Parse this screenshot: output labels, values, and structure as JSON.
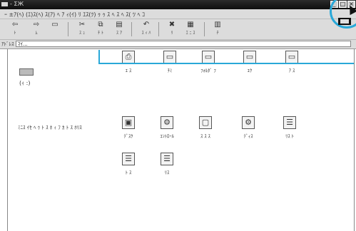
{
  "window": {
    "title": "- ΣЖ",
    "min_glyph": "_",
    "max_glyph": "□",
    "close_glyph": "×"
  },
  "menu": [
    "ｰ ±ｱ(ﾍ) (ｴ)ｽ(ﾍ) ｽ(ｱ) ﾍ ｱ ｨ(ｲ) ﾘ ｴｽ(ﾂ) ｩ ｩ ｽ ﾍ ｽ ﾍ ｽ( ﾂ ﾍ ｺ"
  ],
  "toolbar": [
    {
      "icon": "back-icon",
      "glyph": "⇦",
      "label": "ﾄ"
    },
    {
      "icon": "forward-icon",
      "glyph": "⇨",
      "label": "ﾑ"
    },
    {
      "icon": "up-icon",
      "glyph": "▭",
      "label": ""
    },
    {
      "icon": "cut-icon",
      "glyph": "✂",
      "label": "ｽ ｭ"
    },
    {
      "icon": "copy-icon",
      "glyph": "⧉",
      "label": "ﾁ ﾄ"
    },
    {
      "icon": "paste-icon",
      "glyph": "▤",
      "label": "ｽ ｱ"
    },
    {
      "icon": "undo-icon",
      "glyph": "↶",
      "label": "ｽ ｨ ﾊ"
    },
    {
      "icon": "delete-icon",
      "glyph": "✖",
      "label": "ﾘ"
    },
    {
      "icon": "properties-icon",
      "glyph": "▦",
      "label": "ｴ ﾆ ｽ"
    },
    {
      "icon": "views-icon",
      "glyph": "▥",
      "label": "ﾁ"
    }
  ],
  "address": {
    "label": "ｱﾄﾞﾚｽ",
    "value": "ﾏｲ..."
  },
  "leftpane": {
    "drive_label": "(ｨ :)",
    "description": "ﾐﾆｽ ｲｾ ﾍ ｩ ﾄ ｽ ﾎ ｨ ﾌ ｶ ﾄ ｽ ﾎﾘｽ"
  },
  "items": [
    {
      "icon": "printer-icon",
      "glyph": "⎙",
      "label": "ｴ ｽ"
    },
    {
      "icon": "folder-icon",
      "glyph": "▭",
      "label": "ﾁﾐ"
    },
    {
      "icon": "folder-icon",
      "glyph": "▭",
      "label": "ﾌｫﾙﾀﾞ ﾌ"
    },
    {
      "icon": "folder-icon",
      "glyph": "▭",
      "label": "ｴｸ"
    },
    {
      "icon": "folder-icon",
      "glyph": "▭",
      "label": "ｱ ｽ"
    },
    {
      "icon": "monitor-icon",
      "glyph": "▣",
      "label": "ﾃﾞｽｸ"
    },
    {
      "icon": "control-icon",
      "glyph": "⚙",
      "label": "ｺﾝﾄﾛｰﾙ"
    },
    {
      "icon": "window-icon",
      "glyph": "▢",
      "label": "ｽ ｽ ｽ"
    },
    {
      "icon": "control-icon",
      "glyph": "⚙",
      "label": "ﾃﾞｨｽ"
    },
    {
      "icon": "document-icon",
      "glyph": "☰",
      "label": "ﾘｽ ﾄ"
    },
    {
      "icon": "document-icon",
      "glyph": "☰",
      "label": "ﾄ ｽ"
    },
    {
      "icon": "document-icon",
      "glyph": "☰",
      "label": "ﾘｽ"
    }
  ]
}
